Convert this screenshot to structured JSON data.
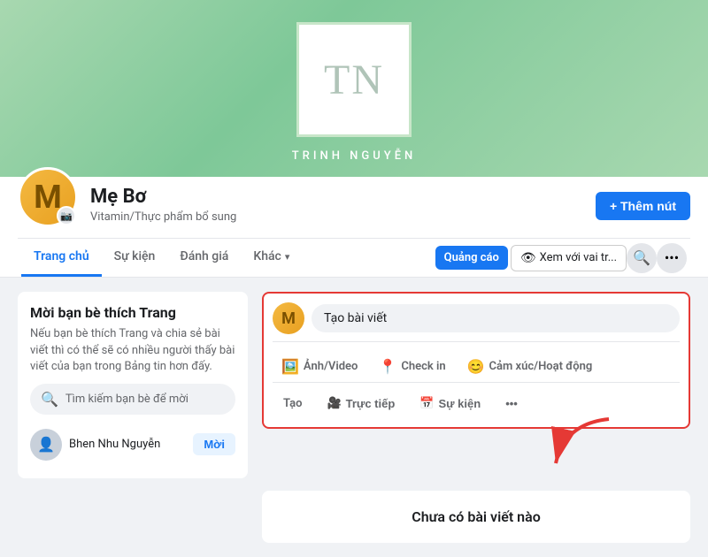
{
  "cover": {
    "logo_letters": "TN",
    "brand_name": "TRINH NGUYỄN"
  },
  "profile": {
    "avatar_letter": "M",
    "name": "Mẹ Bơ",
    "category": "Vitamin/Thực phẩm bổ sung",
    "add_button": "+ Thêm nút"
  },
  "nav": {
    "items": [
      {
        "label": "Trang chủ",
        "active": true
      },
      {
        "label": "Sự kiện",
        "active": false
      },
      {
        "label": "Đánh giá",
        "active": false
      },
      {
        "label": "Khác",
        "active": false,
        "dropdown": true
      }
    ],
    "ad_button": "Quảng cáo",
    "view_as_button": "Xem với vai tr...",
    "search_placeholder": "Tìm kiếm"
  },
  "invite_section": {
    "title": "Mời bạn bè thích Trang",
    "description": "Nếu bạn bè thích Trang và chia sẻ bài viết thì có thể sẽ có nhiều người thấy bài viết của bạn trong Bảng tin hơn đấy.",
    "search_placeholder": "Tìm kiếm bạn bè để mời",
    "friend": {
      "name": "Bhen Nhu Nguyễn",
      "invite_label": "Mời"
    }
  },
  "post_box": {
    "create_label": "Tạo bài viết",
    "actions": [
      {
        "icon": "🖼️",
        "label": "Ảnh/Video",
        "color": "green"
      },
      {
        "icon": "📍",
        "label": "Check in",
        "color": "red"
      },
      {
        "icon": "😊",
        "label": "Cảm xúc/Hoạt động",
        "color": "yellow"
      }
    ],
    "second_row": [
      {
        "icon": "🎥",
        "label": "Trực tiếp"
      },
      {
        "icon": "📅",
        "label": "Sự kiện"
      },
      {
        "icon": "...",
        "label": ""
      }
    ],
    "tao_label": "Tạo"
  },
  "no_posts": {
    "text": "Chưa có bài viết nào"
  }
}
